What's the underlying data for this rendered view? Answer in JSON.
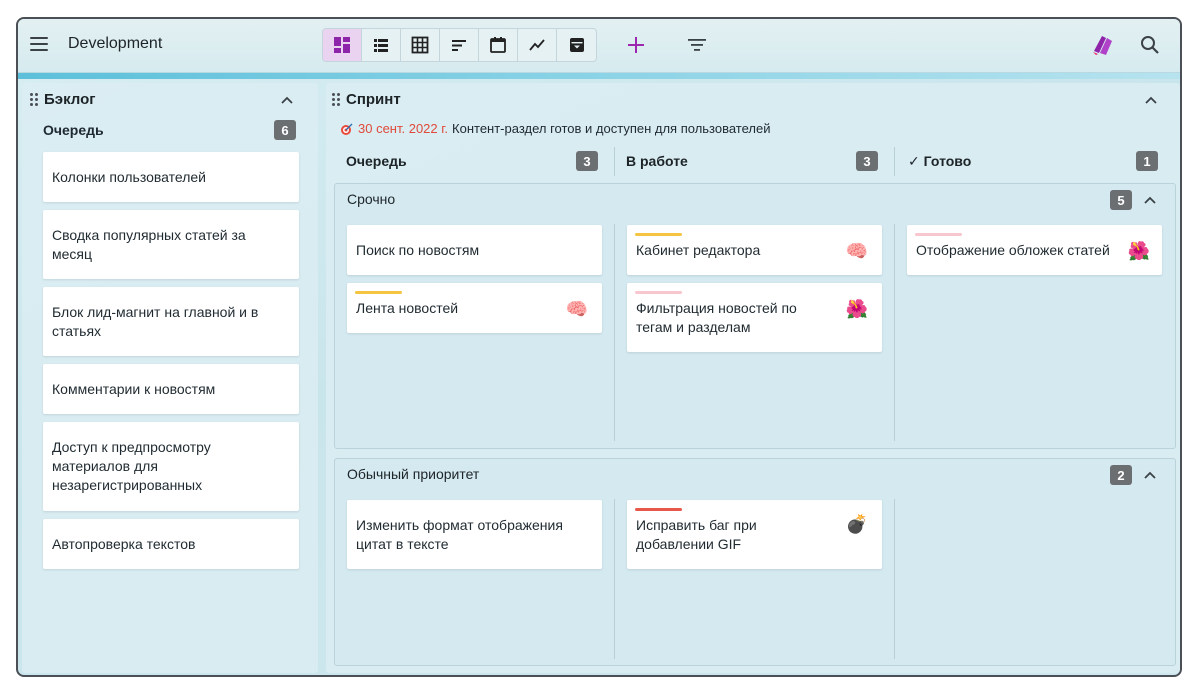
{
  "app": {
    "title": "Development"
  },
  "toolbar": {
    "views": [
      {
        "icon": "board-view-icon"
      },
      {
        "icon": "list-view-icon"
      },
      {
        "icon": "table-view-icon"
      },
      {
        "icon": "sort-view-icon"
      },
      {
        "icon": "calendar-view-icon"
      },
      {
        "icon": "chart-view-icon"
      },
      {
        "icon": "archive-view-icon"
      }
    ],
    "icons": [
      "menu-icon",
      "plus-icon",
      "filter-icon",
      "app-logo-icon",
      "search-icon"
    ],
    "active_view_color": "#ead3f0",
    "accent_color": "#9c27b0"
  },
  "backlog": {
    "title": "Бэклог",
    "queue_label": "Очередь",
    "queue_count": "6",
    "cards": [
      "Колонки пользователей",
      "Сводка популярных статей за месяц",
      "Блок лид-магнит на главной и в статьях",
      "Комментарии к новостям",
      "Доступ к предпросмотру материалов для незарегистрированных",
      "Автопроверка текстов"
    ]
  },
  "sprint": {
    "title": "Спринт",
    "milestone_date": "30 сент. 2022 г.",
    "milestone_text": "Контент-раздел готов и доступен для пользователей",
    "columns": [
      {
        "label": "Очередь",
        "count": "3"
      },
      {
        "label": "В работе",
        "count": "3"
      },
      {
        "label": "✓ Готово",
        "count": "1"
      }
    ],
    "lanes": [
      {
        "title": "Срочно",
        "count": "5",
        "queue": [
          {
            "text": "Поиск по новостям"
          },
          {
            "text": "Лента новостей",
            "bar_color": "#f5c542",
            "emoji": "🧠"
          }
        ],
        "in_progress": [
          {
            "text": "Кабинет редактора",
            "bar_color": "#f5c542",
            "emoji": "🧠"
          },
          {
            "text": "Фильтрация новостей по тегам и разделам",
            "bar_color": "#f7c6cf",
            "emoji": "🌺"
          }
        ],
        "done": [
          {
            "text": "Отображение обложек статей",
            "bar_color": "#f7c6cf",
            "emoji": "🌺"
          }
        ]
      },
      {
        "title": "Обычный приоритет",
        "count": "2",
        "queue": [
          {
            "text": "Изменить формат отображения цитат в тексте"
          }
        ],
        "in_progress": [
          {
            "text": "Исправить баг при добавлении GIF",
            "bar_color": "#e8584a",
            "emoji": "💣"
          }
        ],
        "done": []
      }
    ]
  }
}
